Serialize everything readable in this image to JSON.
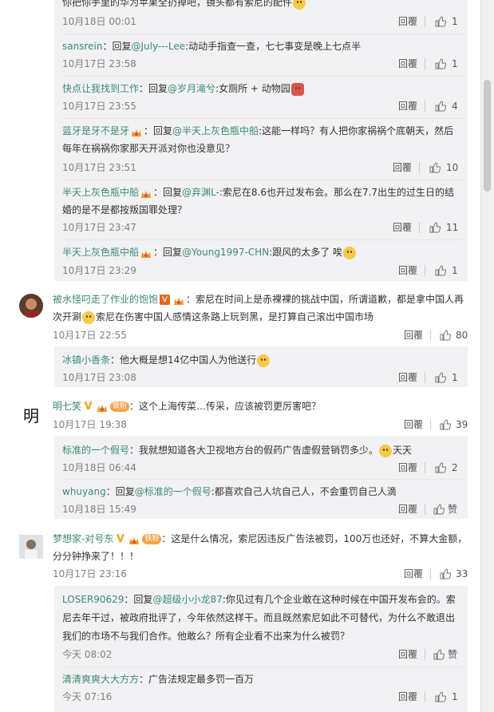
{
  "icons": {
    "like": "thumb-up-icon",
    "emoji": "smiley-emoji-icon",
    "vip": "v-badge-icon",
    "crown": "crown-badge-icon",
    "fan": "fan-badge-icon"
  },
  "colors": {
    "name": "#3c8a70",
    "text": "#333333",
    "meta": "#808080",
    "sub_bg": "#f2f2f5",
    "vip_orange": "#f29a2e",
    "vip_red": "#e14c3c"
  },
  "reply_label": "回覆",
  "c0": {
    "text": "你把你手里的华为苹果全扔掉吧，镜头都有索尼的配件",
    "time": "10月18日 00:01",
    "likes": "1"
  },
  "c1": {
    "name": "sansrein",
    "reply": "：回复",
    "at": "@July---Lee",
    "text": ":动动手指查一查，七七事变是晚上七点半",
    "time": "10月17日 23:58",
    "likes": "1"
  },
  "c2": {
    "name": "快点让我找到工作",
    "reply": "：回复",
    "at": "@岁月滝兮",
    "text": ":女厕所 + 动物园",
    "time": "10月17日 23:55",
    "likes": "4"
  },
  "c3": {
    "name": "蓝牙是牙不是牙",
    "reply": "：回复",
    "at": "@半天上灰色瓶中船",
    "text": ":这能一样吗？有人把你家祸祸个底朝天，然后",
    "text2": "每年在祸祸你家那天开派对你也没意见？",
    "time": "10月17日 23:51",
    "likes": "10"
  },
  "c4": {
    "name": "半天上灰色瓶中船",
    "reply": "：回复",
    "at": "@弃渊L-",
    "text": ":索尼在8.6也开过发布会。那么在7.7出生的过生日的结",
    "text2": "婚的是不是都按叛国罪处理？",
    "time": "10月17日 23:47",
    "likes": "11"
  },
  "c5": {
    "name": "半天上灰色瓶中船",
    "reply": "：回复",
    "at": "@Young1997-CHN",
    "text": ":跟风的太多了 唉",
    "time": "10月17日 23:29",
    "likes": "1"
  },
  "m1": {
    "name": "被水怪叼走了作业的饱饱",
    "text": "：索尼在时间上是赤裸裸的挑战中国，所谓道歉，都是拿中国人再",
    "text2a": "次开涮",
    "text2b": "索尼在伤害中国人感情这条路上玩到黑，是打算自己滚出中国市场",
    "time": "10月17日 22:55",
    "likes": "80"
  },
  "m1s": {
    "name": "冰镇小香条",
    "text": "：他大概是想14亿中国人为他送行",
    "time": "10月17日 23:08",
    "likes": "1"
  },
  "m2": {
    "name": "明七笑",
    "fan": "铁粉",
    "text": "：这个上海传菜…传采，应该被罚更厉害吧？",
    "time": "10月17日 19:38",
    "likes": "39",
    "avatar_char": "明"
  },
  "m2s1": {
    "name": "标准的一个假号",
    "text": "：我就想知道各大卫视地方台的假药广告虚假营销罚多少。",
    "text_end": "天天",
    "time": "10月18日 06:44",
    "likes": "2"
  },
  "m2s2": {
    "name": "whuyang",
    "reply": "：回复",
    "at": "@标准的一个假号",
    "text": ":都喜欢自己人坑自己人，不会重罚自己人滴",
    "time": "10月18日 15:49",
    "likes": "赞"
  },
  "m3": {
    "name": "梦想家-对号东",
    "fan": "铁粉",
    "text": "：这是什么情况，索尼因违反广告法被罚，100万也还好，不算大金额，",
    "text2": "分分钟挣来了！！！",
    "time": "10月17日 23:16",
    "likes": "33"
  },
  "m3s1": {
    "name": "LOSER90629",
    "reply": "：回复",
    "at": "@超级小小龙87",
    "text": ":你见过有几个企业敢在这种时候在中国开发布会的。索",
    "text2": "尼去年干过，被政府批评了，今年依然这样干。而且既然索尼如此不可替代，为什么不敢退出",
    "text3": "我们的市场不与我们合作。他敢么？所有企业看不出来为什么被罚？",
    "time": "今天 08:02",
    "likes": "赞"
  },
  "m3s2": {
    "name": "清清爽爽大大方方",
    "text": "：广告法规定最多罚一百万",
    "time": "今天 07:16",
    "likes": "1"
  }
}
